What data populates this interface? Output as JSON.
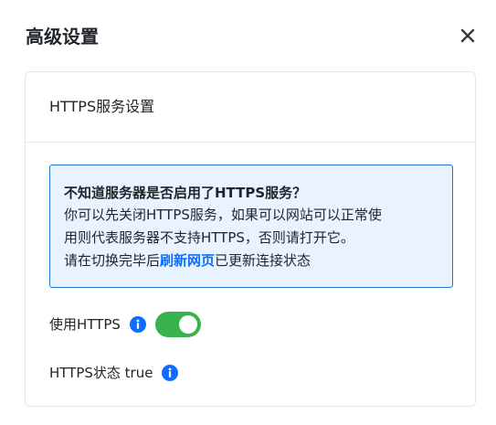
{
  "dialog": {
    "title": "高级设置",
    "close_icon": "close-icon"
  },
  "card": {
    "title": "HTTPS服务设置"
  },
  "alert": {
    "title": "不知道服务器是否启用了HTTPS服务？",
    "line1": "你可以先关闭HTTPS服务，如果可以网站可以正常使",
    "line2": "用则代表服务器不支持HTTPS，否则请打开它。",
    "line3_prefix": "请在切换完毕后",
    "line3_link": "刷新网页",
    "line3_suffix": "已更新连接状态"
  },
  "https_toggle": {
    "label": "使用HTTPS",
    "enabled": true,
    "info_icon": "info-icon"
  },
  "https_status": {
    "label": "HTTPS状态 true",
    "info_icon": "info-icon"
  },
  "colors": {
    "accent": "#0d6efd",
    "toggle_on": "#37b24d",
    "alert_bg": "#e8f3ff",
    "alert_border": "#1f74d5"
  }
}
